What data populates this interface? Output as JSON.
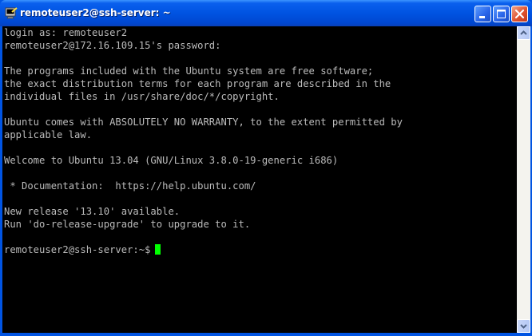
{
  "window": {
    "title": "remoteuser2@ssh-server: ~",
    "icon": "putty-terminal-icon",
    "buttons": {
      "minimize": "minimize-icon",
      "maximize": "maximize-icon",
      "close": "close-icon"
    }
  },
  "terminal": {
    "lines": [
      "login as: remoteuser2",
      "remoteuser2@172.16.109.15's password:",
      "",
      "The programs included with the Ubuntu system are free software;",
      "the exact distribution terms for each program are described in the",
      "individual files in /usr/share/doc/*/copyright.",
      "",
      "Ubuntu comes with ABSOLUTELY NO WARRANTY, to the extent permitted by",
      "applicable law.",
      "",
      "Welcome to Ubuntu 13.04 (GNU/Linux 3.8.0-19-generic i686)",
      "",
      " * Documentation:  https://help.ubuntu.com/",
      "",
      "New release '13.10' available.",
      "Run 'do-release-upgrade' to upgrade to it.",
      "",
      "remoteuser2@ssh-server:~$"
    ],
    "text_color": "#bbbbbb",
    "background": "#000000",
    "cursor_color": "#00ff00"
  },
  "colors": {
    "titlebar": "#0054e3",
    "close_button": "#e0522e"
  }
}
